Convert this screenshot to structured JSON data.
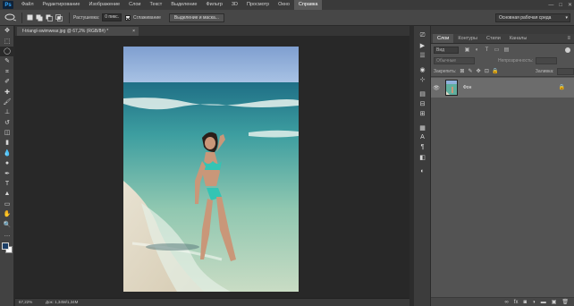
{
  "app": {
    "logo": "Ps",
    "window_controls": [
      "—",
      "□",
      "✕"
    ]
  },
  "menu": {
    "items": [
      "Файл",
      "Редактирование",
      "Изображение",
      "Слои",
      "Текст",
      "Выделение",
      "Фильтр",
      "3D",
      "Просмотр",
      "Окно",
      "Справка"
    ],
    "active_index": 10
  },
  "options": {
    "feather_label": "Растушевка:",
    "feather_value": "0 пикс.",
    "antialias_label": "Сглаживание",
    "antialias_checked": true,
    "refine_button": "Выделение и маска...",
    "workspace": "Основная рабочая среда"
  },
  "tools": {
    "items": [
      "move-tool",
      "marquee-tool",
      "lasso-tool",
      "quick-selection-tool",
      "crop-tool",
      "eyedropper-tool",
      "healing-brush-tool",
      "brush-tool",
      "clone-stamp-tool",
      "history-brush-tool",
      "eraser-tool",
      "gradient-tool",
      "blur-tool",
      "dodge-tool",
      "pen-tool",
      "type-tool",
      "path-selection-tool",
      "rectangle-tool",
      "hand-tool",
      "zoom-tool",
      "more-tools"
    ],
    "glyphs": [
      "✥",
      "⬚",
      "◯",
      "✎",
      "⌗",
      "✐",
      "✚",
      "🖌",
      "⊥",
      "↺",
      "◫",
      "▮",
      "💧",
      "●",
      "✒",
      "T",
      "▲",
      "▭",
      "✋",
      "🔍",
      "…"
    ],
    "active_index": 2,
    "foreground_color": "#1d3f66",
    "background_color": "#ffffff"
  },
  "document": {
    "tab_title": "f-triangl-swimwear.jpg @ 67,2% (RGB/8#) *",
    "close": "×",
    "zoom": "67,22%",
    "doc_info": "Док: 1,34М/1,34М"
  },
  "icon_bar": {
    "icons": [
      "history-icon",
      "actions-icon",
      "properties-icon",
      "adjustments-icon",
      "brush-settings-icon",
      "clone-source-icon",
      "channels-icon",
      "paths-icon",
      "swatches-icon",
      "character-icon",
      "paragraph-icon",
      "styles-icon",
      "navigator-icon"
    ],
    "glyphs": [
      "⎚",
      "▶",
      "☰",
      "◉",
      "⊹",
      "▤",
      "⊟",
      "⊞",
      "▦",
      "A",
      "¶",
      "◧",
      "◐"
    ]
  },
  "layers_panel": {
    "tabs": [
      "Слои",
      "Контуры",
      "Стили",
      "Каналы"
    ],
    "active_tab_index": 0,
    "menu_icon": "≡",
    "filter_label": "Вид",
    "blend_mode": "Обычные",
    "opacity_label": "Непрозрачность:",
    "lock_label": "Закрепить:",
    "fill_label": "Заливка:",
    "layers": [
      {
        "name": "Фон",
        "visible": true,
        "locked": true
      }
    ],
    "footer_icons": [
      "link-icon",
      "fx-icon",
      "mask-icon",
      "adjustment-layer-icon",
      "group-icon",
      "new-layer-icon",
      "trash-icon"
    ],
    "footer_glyphs": [
      "∞",
      "fx",
      "◙",
      "◑",
      "▬",
      "▣",
      "🗑"
    ]
  }
}
